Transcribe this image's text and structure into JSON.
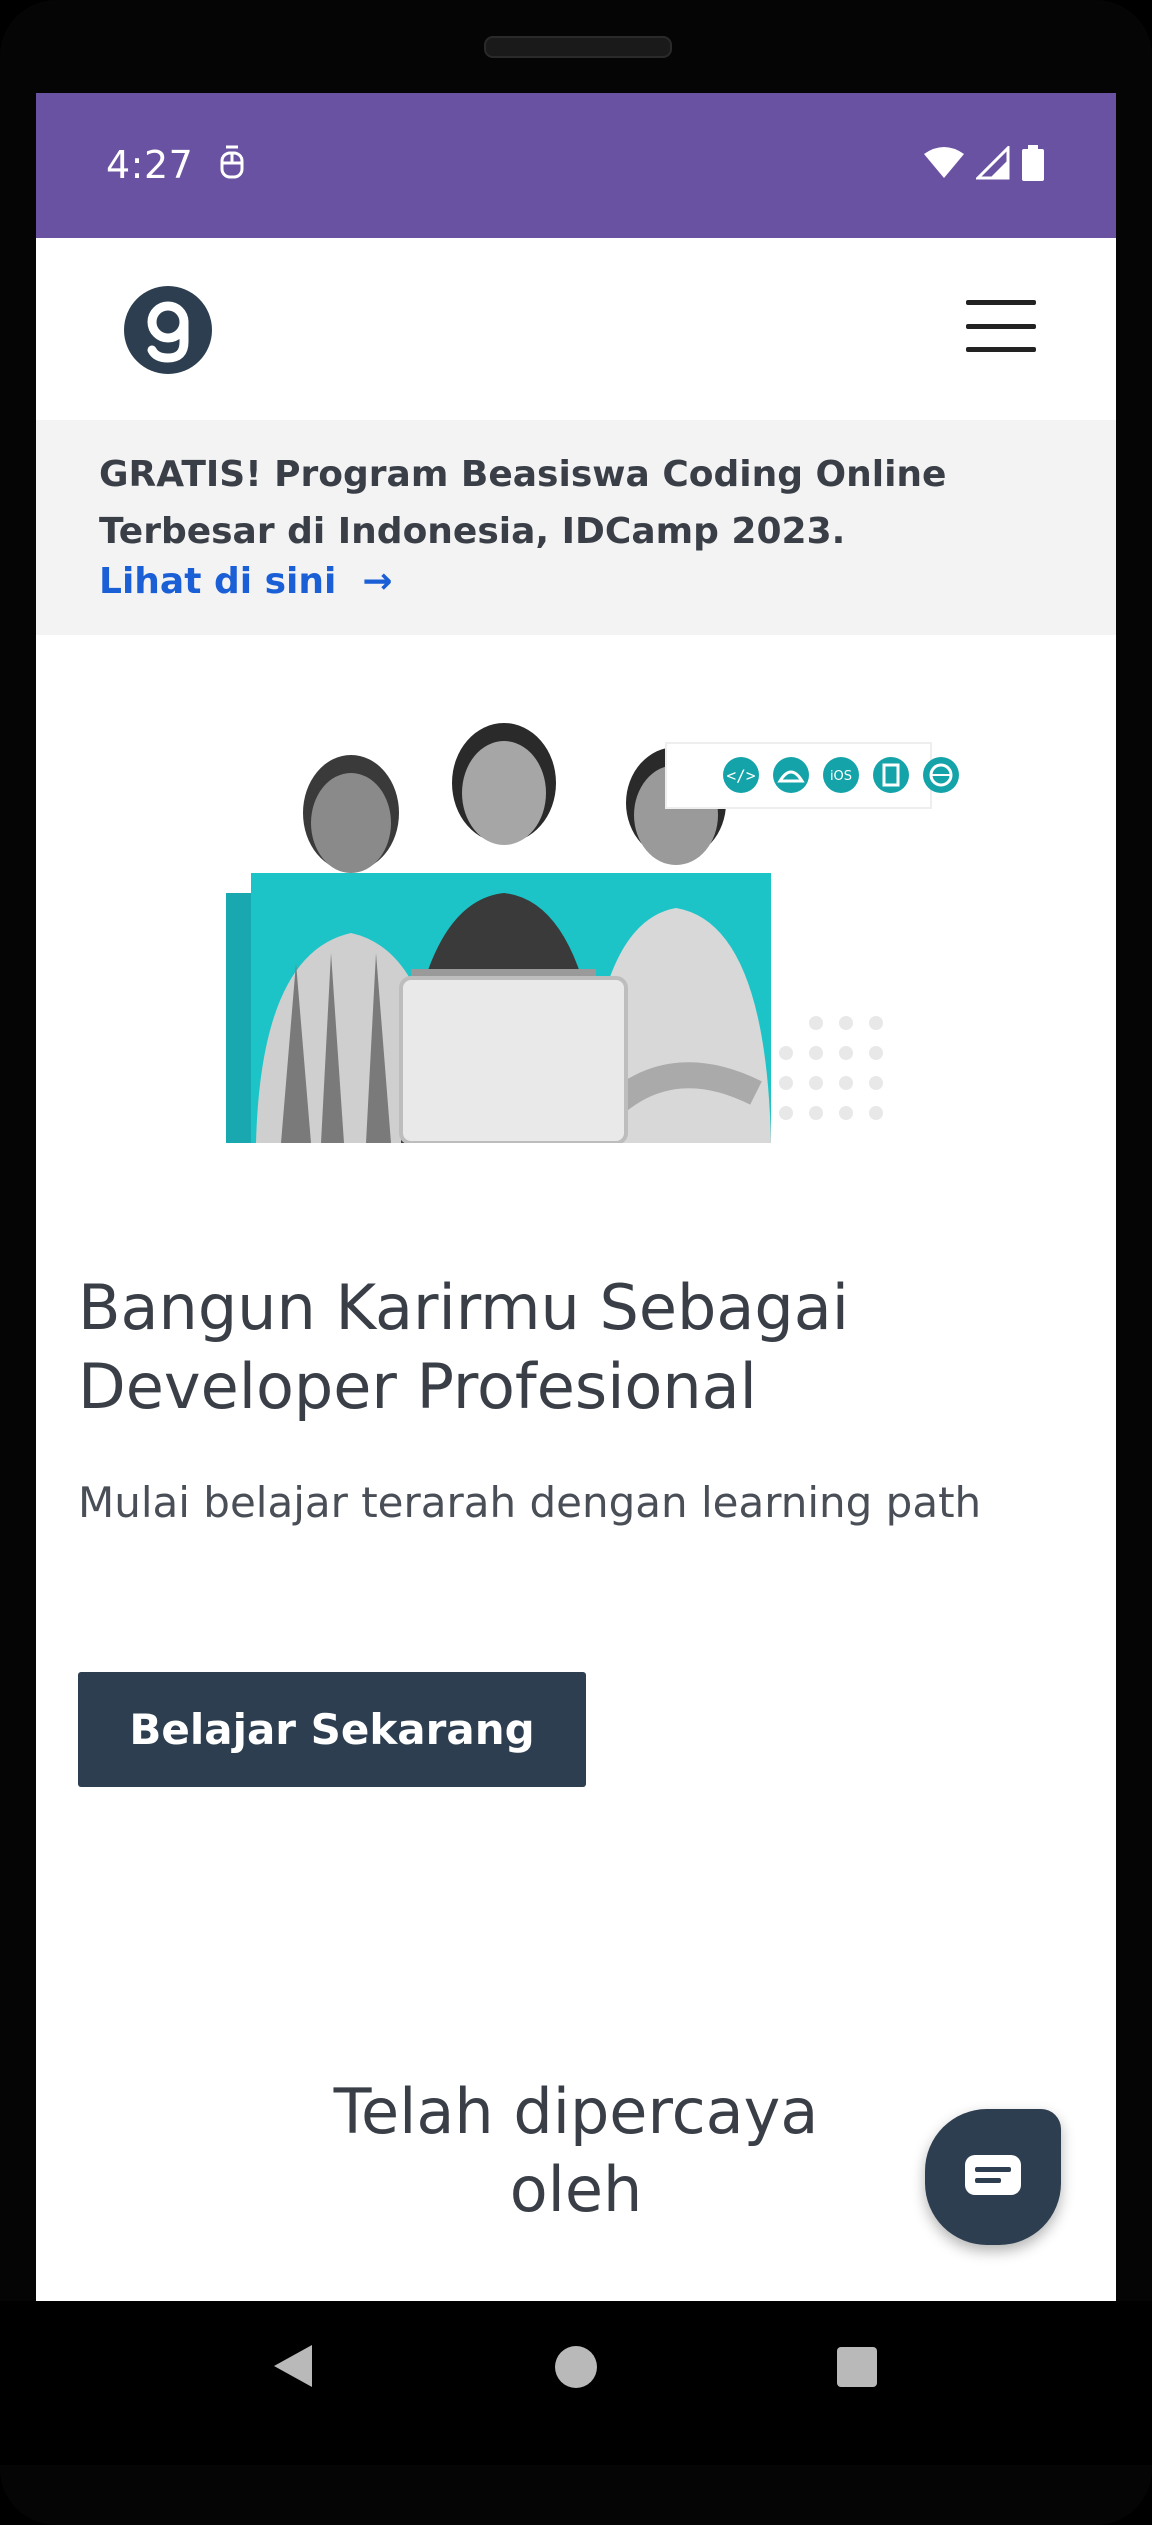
{
  "status_bar": {
    "time": "4:27",
    "background": "#6a52a3"
  },
  "nav": {
    "logo_icon": "dicoding-logo-icon",
    "menu_icon": "hamburger-menu-icon"
  },
  "banner": {
    "text": "GRATIS! Program Beasiswa Coding Online Terbesar di Indonesia, IDCamp 2023.",
    "link_label": "Lihat di sini",
    "link_arrow": "→",
    "link_color": "#1a5fd6"
  },
  "hero": {
    "image_badges": [
      "code-icon",
      "android-icon",
      "iOS",
      "multiplatform-icon",
      "web-icon"
    ],
    "title": "Bangun Karirmu Sebagai Developer Profesional",
    "subtitle": "Mulai belajar terarah dengan learning path",
    "cta_label": "Belajar Sekarang",
    "cta_color": "#2d3e50"
  },
  "trusted": {
    "heading_line1": "Telah dipercaya",
    "heading_line2": "oleh"
  },
  "chat": {
    "icon": "chat-bubble-icon"
  },
  "system_nav": {
    "back_icon": "back-triangle-icon",
    "home_icon": "home-circle-icon",
    "recents_icon": "recents-square-icon"
  }
}
